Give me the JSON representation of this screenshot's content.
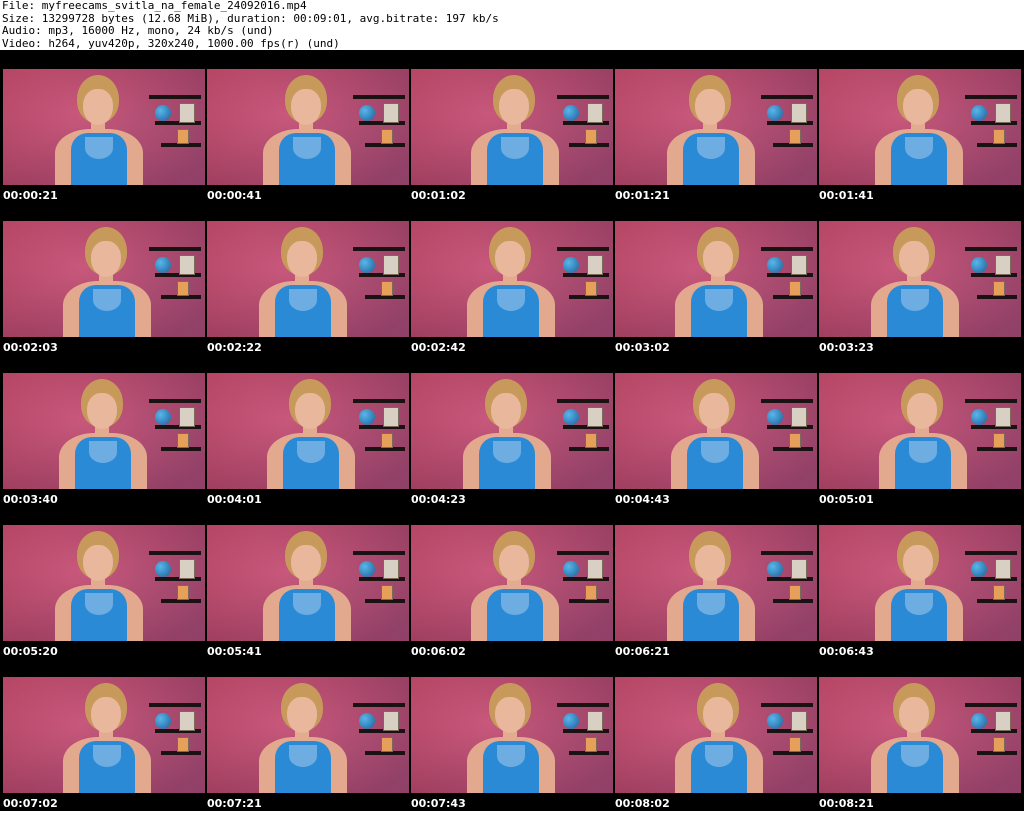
{
  "header": {
    "file_line": "File: myfreecams_svitla_na_female_24092016.mp4",
    "size_line": "Size: 13299728 bytes (12.68 MiB), duration: 00:09:01, avg.bitrate: 197 kb/s",
    "audio_line": "Audio: mp3, 16000 Hz, mono, 24 kb/s (und)",
    "video_line": "Video: h264, yuv420p, 320x240, 1000.00 fps(r) (und)"
  },
  "thumbnails": [
    {
      "timestamp": "00:00:21"
    },
    {
      "timestamp": "00:00:41"
    },
    {
      "timestamp": "00:01:02"
    },
    {
      "timestamp": "00:01:21"
    },
    {
      "timestamp": "00:01:41"
    },
    {
      "timestamp": "00:02:03"
    },
    {
      "timestamp": "00:02:22"
    },
    {
      "timestamp": "00:02:42"
    },
    {
      "timestamp": "00:03:02"
    },
    {
      "timestamp": "00:03:23"
    },
    {
      "timestamp": "00:03:40"
    },
    {
      "timestamp": "00:04:01"
    },
    {
      "timestamp": "00:04:23"
    },
    {
      "timestamp": "00:04:43"
    },
    {
      "timestamp": "00:05:01"
    },
    {
      "timestamp": "00:05:20"
    },
    {
      "timestamp": "00:05:41"
    },
    {
      "timestamp": "00:06:02"
    },
    {
      "timestamp": "00:06:21"
    },
    {
      "timestamp": "00:06:43"
    },
    {
      "timestamp": "00:07:02"
    },
    {
      "timestamp": "00:07:21"
    },
    {
      "timestamp": "00:07:43"
    },
    {
      "timestamp": "00:08:02"
    },
    {
      "timestamp": "00:08:21"
    }
  ]
}
